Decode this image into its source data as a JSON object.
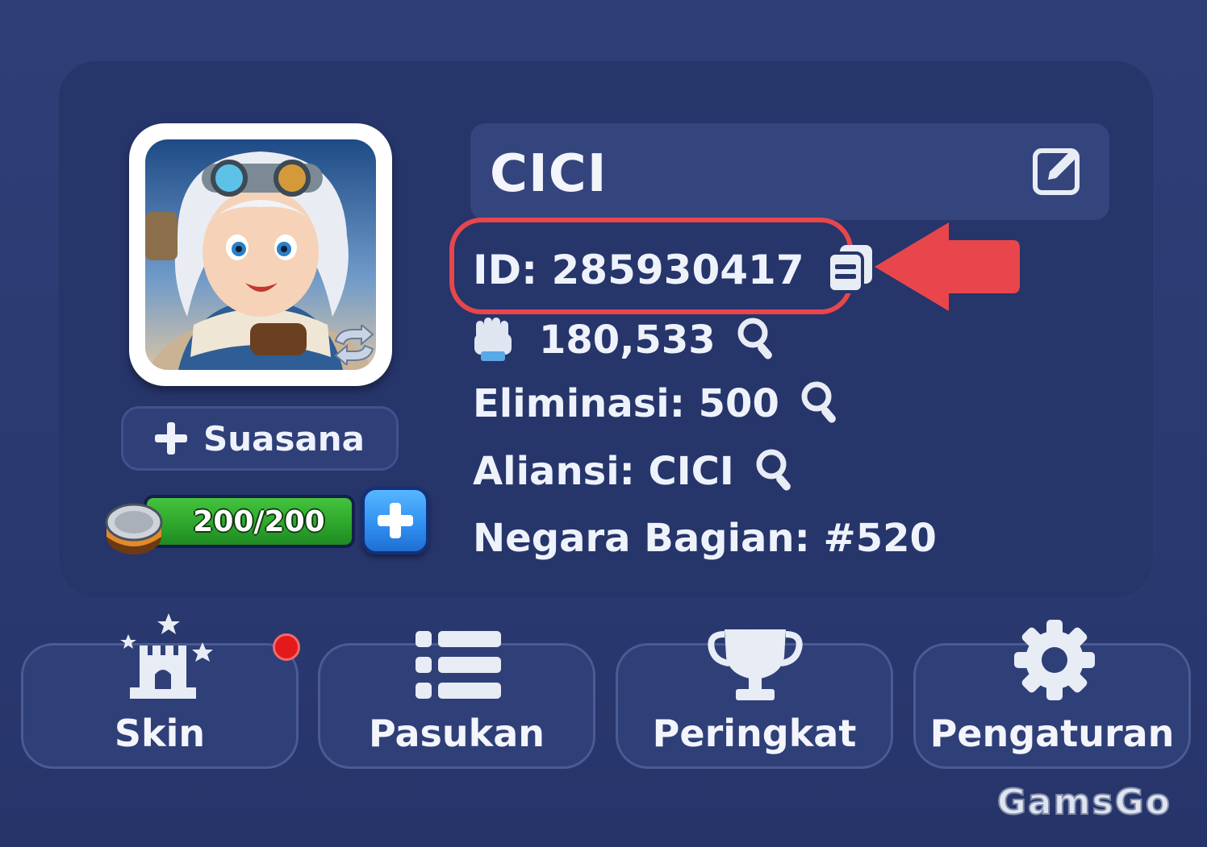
{
  "profile": {
    "name": "CICI",
    "id_text": "ID: 285930417",
    "power": "180,533",
    "elimination": "Eliminasi: 500",
    "alliance": "Aliansi: CICI",
    "state": "Negara Bagian: #520"
  },
  "avatar": {
    "mood_button_label": "Suasana"
  },
  "energy": {
    "value": "200/200"
  },
  "tabs": [
    {
      "label": "Skin"
    },
    {
      "label": "Pasukan"
    },
    {
      "label": "Peringkat"
    },
    {
      "label": "Pengaturan"
    }
  ],
  "watermark": "GamsGo",
  "colors": {
    "background": "#2e3f78",
    "panel": "#26356a",
    "highlight": "#e8464c",
    "energy_green": "#2ea72c",
    "plus_blue": "#2e8ef0",
    "notification": "#e3191b"
  },
  "icons": [
    "edit-icon",
    "copy-icon",
    "fist-icon",
    "search-icon",
    "plus-icon",
    "swap-icon",
    "castle-icon",
    "list-icon",
    "trophy-icon",
    "gear-icon",
    "arrow-icon"
  ]
}
